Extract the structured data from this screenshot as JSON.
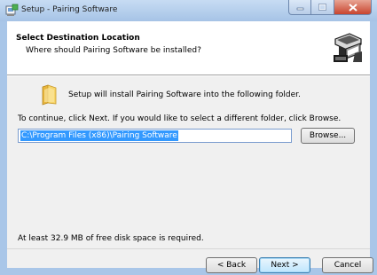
{
  "window": {
    "title": "Setup - Pairing Software"
  },
  "header": {
    "title": "Select Destination Location",
    "subtitle": "Where should Pairing Software be installed?"
  },
  "body": {
    "install_line": "Setup will install Pairing Software into the following folder.",
    "continue_line": "To continue, click Next. If you would like to select a different folder, click Browse.",
    "path_value": "C:\\Program Files (x86)\\Pairing Software",
    "browse_label": "Browse...",
    "disk_space": "At least 32.9 MB of free disk space is required."
  },
  "buttons": {
    "back": "< Back",
    "next": "Next >",
    "cancel": "Cancel"
  },
  "icons": {
    "window": "setup-app-icon",
    "header": "computer-install-icon",
    "folder": "folder-icon",
    "minimize": "minimize-icon",
    "maximize": "maximize-icon",
    "close": "close-icon"
  },
  "colors": {
    "title_bar": "#a9c6e8",
    "close_button": "#c8442e",
    "selection": "#3399ff",
    "dialog_bg": "#f0f0f0"
  }
}
